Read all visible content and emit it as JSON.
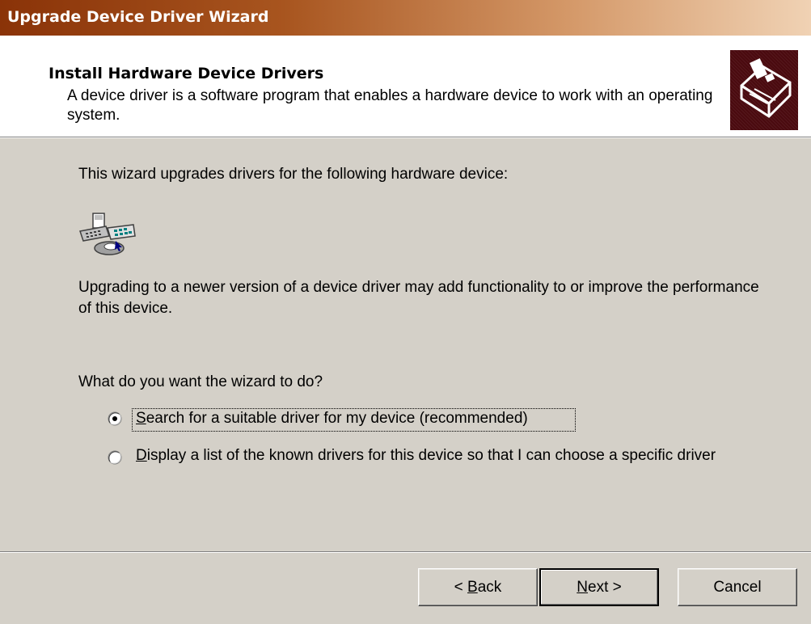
{
  "window": {
    "title": "Upgrade Device Driver Wizard"
  },
  "header": {
    "title": "Install Hardware Device Drivers",
    "description": "A device driver is a software program that enables a hardware device to work with an operating system.",
    "icon": "hardware-wizard-icon"
  },
  "body": {
    "intro": "This wizard upgrades drivers for the following hardware device:",
    "device_icon": "keyboard-mouse-device-icon",
    "upgrade_note": "Upgrading to a newer version of a device driver may add functionality to or improve the performance of this device.",
    "question": "What do you want the wizard to do?",
    "options": [
      {
        "label": "Search for a suitable driver for my device (recommended)",
        "accesskey": "S",
        "selected": true
      },
      {
        "label": "Display a list of the known drivers for this device so that I can choose a specific driver",
        "accesskey": "D",
        "selected": false
      }
    ]
  },
  "buttons": {
    "back_label": "< Back",
    "next_label": "Next >",
    "cancel_label": "Cancel"
  },
  "colors": {
    "dialog_face": "#d4d0c8",
    "title_start": "#8a3308",
    "title_end": "#f0d2b4"
  }
}
